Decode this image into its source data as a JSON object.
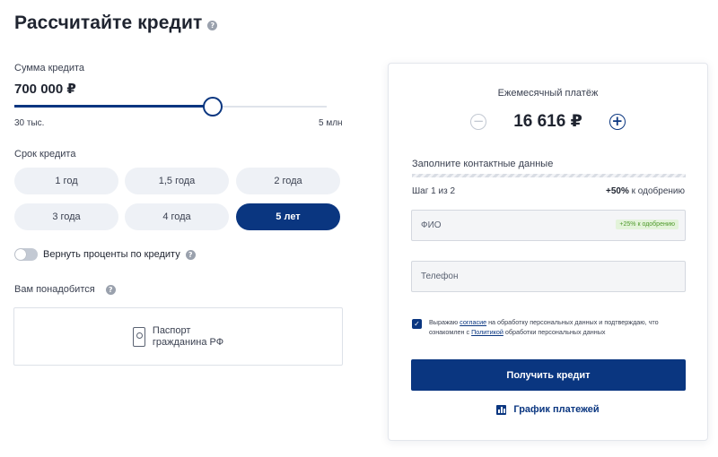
{
  "header": {
    "title": "Рассчитайте кредит",
    "help_glyph": "?"
  },
  "amount": {
    "label": "Сумма кредита",
    "value": "700 000 ₽",
    "slider_position_fraction": 0.635,
    "min_label": "30 тыс.",
    "max_label": "5 млн"
  },
  "term": {
    "label": "Срок кредита",
    "options": [
      "1 год",
      "1,5 года",
      "2 года",
      "3 года",
      "4 года",
      "5 лет"
    ],
    "selected": "5 лет"
  },
  "refund": {
    "label": "Вернуть проценты по кредиту",
    "enabled": false
  },
  "documents": {
    "label": "Вам понадобится",
    "item": "Паспорт гражданина РФ",
    "item_line1": "Паспорт",
    "item_line2": "гражданина РФ"
  },
  "card": {
    "monthly_label": "Ежемесячный платёж",
    "monthly_value": "16 616 ₽",
    "minus_glyph": "−",
    "plus_glyph": "+",
    "contacts_title": "Заполните контактные данные",
    "step": "Шаг 1 из 2",
    "bonus_value": "+50%",
    "bonus_text": " к одобрению",
    "fio_placeholder": "ФИО",
    "fio_badge": "+25% к одобрению",
    "phone_placeholder": "Телефон",
    "consent": {
      "checked": true,
      "part1": "Выражаю ",
      "link1": "согласие",
      "part2": " на обработку персональных данных и подтверждаю, что ознакомлен с ",
      "link2": "Политикой",
      "part3": " обработки персональных данных"
    },
    "submit_label": "Получить кредит",
    "schedule_label": "График платежей"
  },
  "colors": {
    "brand": "#0a3680",
    "accent_green": "#4f9a2c",
    "pill_bg": "#eef1f6"
  }
}
